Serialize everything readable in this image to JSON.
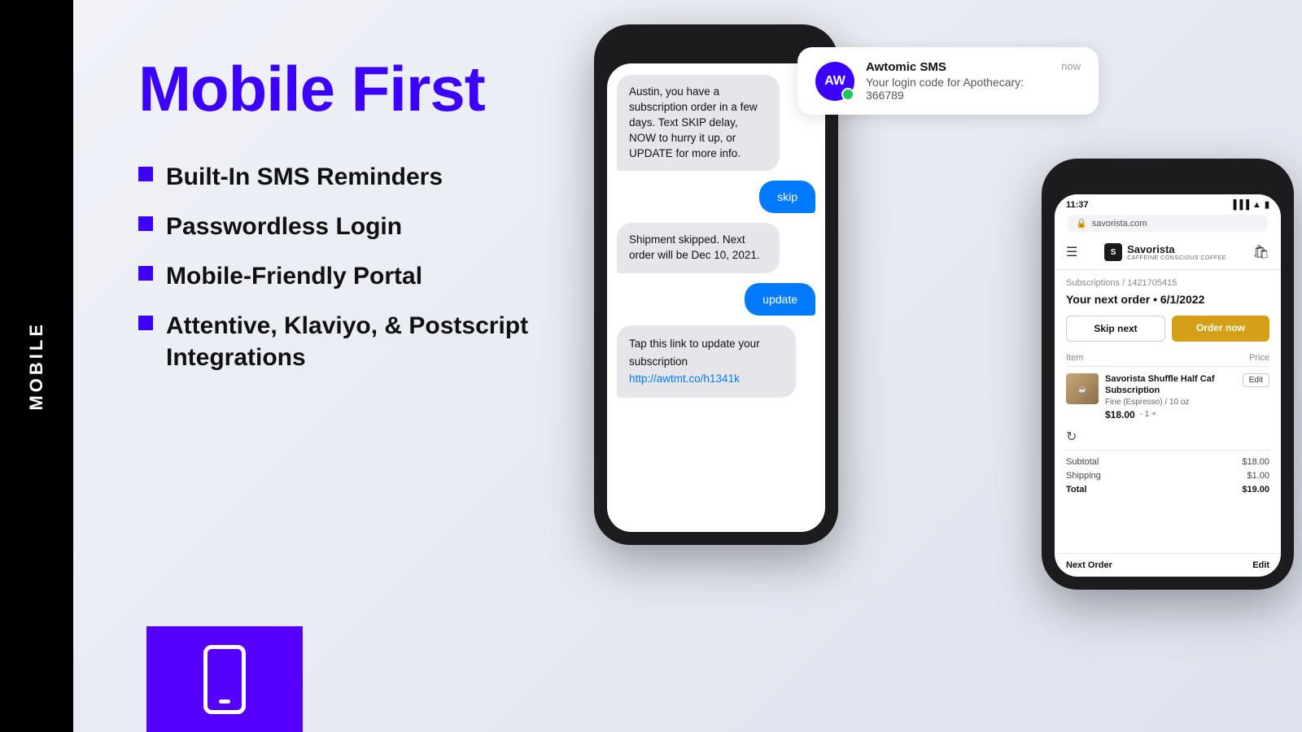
{
  "sidebar": {
    "label": "MOBILE"
  },
  "hero": {
    "title": "Mobile First",
    "bullets": [
      "Built-In SMS Reminders",
      "Passwordless Login",
      "Mobile-Friendly Portal",
      "Attentive, Klaviyo, & Postscript Integrations"
    ]
  },
  "notification": {
    "sender": "Awtomic SMS",
    "avatar_initials": "AW",
    "message": "Your login code for Apothecary: 366789",
    "time": "now"
  },
  "sms_chat": {
    "message1": "Austin, you have a subscription order in a few days. Text SKIP delay, NOW to hurry it up, or UPDATE for more info.",
    "reply1": "skip",
    "message2": "Shipment skipped. Next order will be Dec 10, 2021.",
    "reply2": "update",
    "message3": "Tap this link to update your subscription",
    "link_text": "http://awtmt.co/h1341k"
  },
  "portal": {
    "time": "11:37",
    "url": "savorista.com",
    "brand": "Savorista",
    "brand_sub": "CAFFEINE CONSCIOUS COFFEE",
    "breadcrumb": "Subscriptions / 1421705415",
    "order_title": "Your next order • 6/1/2022",
    "btn_skip": "Skip next",
    "btn_order": "Order now",
    "table_item": "Item",
    "table_price": "Price",
    "product_name": "Savorista Shuffle Half Caf Subscription",
    "product_variant": "Fine (Espresso) / 10 oz",
    "product_price": "$18.00",
    "product_qty": "- 1 +",
    "product_edit": "Edit",
    "subtotal_label": "Subtotal",
    "subtotal_value": "$18.00",
    "shipping_label": "Shipping",
    "shipping_value": "$1.00",
    "total_label": "Total",
    "total_value": "$19.00",
    "footer_label": "Next Order",
    "footer_action": "Edit"
  }
}
